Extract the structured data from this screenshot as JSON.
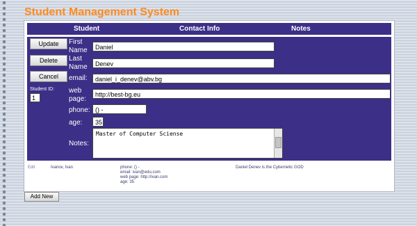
{
  "app": {
    "title": "Student Management System"
  },
  "columns": {
    "student": "Student",
    "contact": "Contact Info",
    "notes": "Notes"
  },
  "buttons": {
    "update": "Update",
    "delete": "Delete",
    "cancel": "Cancel",
    "add_new": "Add New"
  },
  "student_id": {
    "label": "Student ID:",
    "value": "1"
  },
  "form": {
    "first_name_label": "First Name",
    "first_name_value": "Daniel",
    "last_name_label": "Last Name",
    "last_name_value": "Denev",
    "email_label": "email:",
    "email_value": "daniel_i_denev@abv.bg",
    "web_label": "web page:",
    "web_value": "http://best-bg.eu",
    "phone_label": "phone:",
    "phone_value": "() -",
    "age_label": "age:",
    "age_value": "35",
    "notes_label": "Notes:",
    "notes_value": "Master of Computer Sciense"
  },
  "rows": [
    {
      "action": "Edit",
      "name": "Ivanov, Ivan",
      "phone": "phone: () -",
      "email": "email: ivan@edu.com",
      "web": "web page: http://ivan.com",
      "age": "age: 35",
      "notes": "Daniel Denev is the Cybernetic GOD"
    }
  ]
}
